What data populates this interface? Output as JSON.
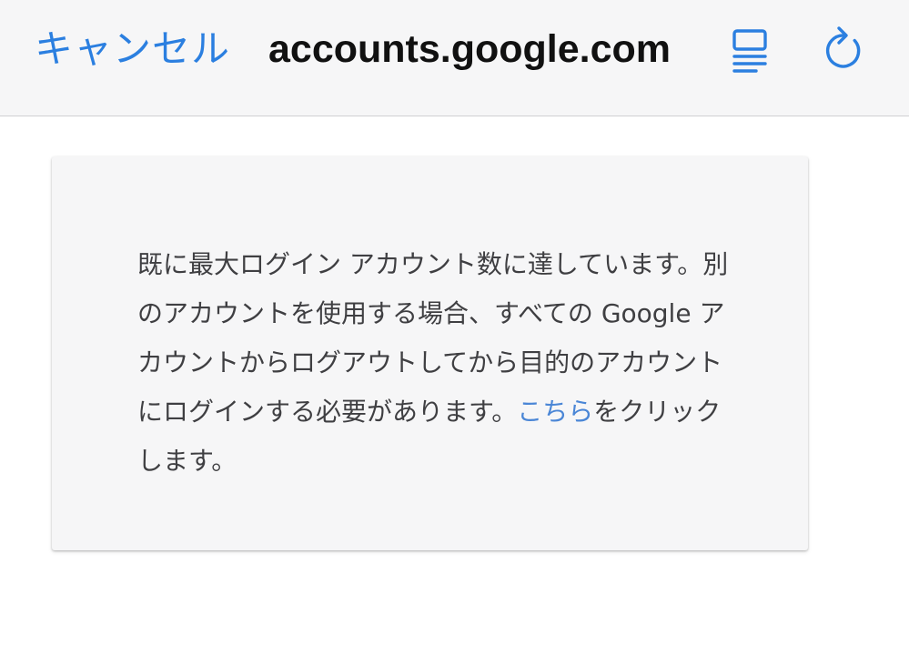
{
  "nav": {
    "cancel_label": "キャンセル",
    "domain": "accounts.google.com",
    "reader_icon": "reader-view-icon",
    "reload_icon": "reload-icon",
    "accent_color": "#2b7fe0"
  },
  "message": {
    "text_before": "既に最大ログイン アカウント数に達しています。別のアカウントを使用する場合、すべての Google アカウントからログアウトしてから目的のアカウントにログインする必要があります。",
    "link_text": "こちら",
    "text_after": "をクリックします。",
    "link_color": "#4a86d6"
  }
}
